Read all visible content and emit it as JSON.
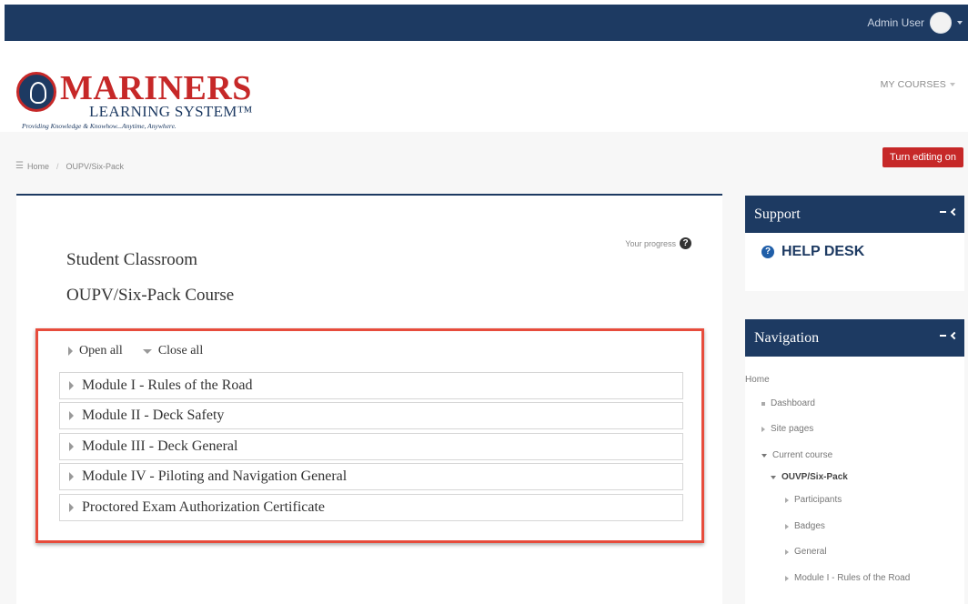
{
  "topbar": {
    "user_name": "Admin User"
  },
  "header": {
    "logo_title": "MARINERS",
    "logo_subtitle": "LEARNING SYSTEM™",
    "logo_tagline": "Providing Knowledge & Knowhow...Anytime, Anywhere.",
    "my_courses": "MY COURSES"
  },
  "breadcrumb": {
    "home": "Home",
    "current": "OUPV/Six-Pack"
  },
  "edit_button": "Turn editing on",
  "course": {
    "progress_label": "Your progress",
    "category": "Student Classroom",
    "name": "OUPV/Six-Pack Course",
    "open_all": "Open all",
    "close_all": "Close all",
    "modules": [
      "Module I - Rules of the Road",
      "Module II - Deck Safety",
      "Module III - Deck General",
      "Module IV - Piloting and Navigation General",
      "Proctored Exam Authorization Certificate"
    ]
  },
  "support": {
    "title": "Support",
    "help_desk": "HELP DESK"
  },
  "navigation": {
    "title": "Navigation",
    "home": "Home",
    "dashboard": "Dashboard",
    "site_pages": "Site pages",
    "current_course": "Current course",
    "course_short": "OUVP/Six-Pack",
    "participants": "Participants",
    "badges": "Badges",
    "general": "General",
    "module1": "Module I - Rules of the Road"
  },
  "colors": {
    "brand_navy": "#1d3a62",
    "accent_red": "#c62828",
    "highlight_border": "#e74c3c"
  },
  "icons": [
    "avatar",
    "home-icon",
    "question-icon",
    "minus-icon",
    "chevron-left-icon",
    "triangle-right-icon",
    "triangle-down-icon"
  ]
}
